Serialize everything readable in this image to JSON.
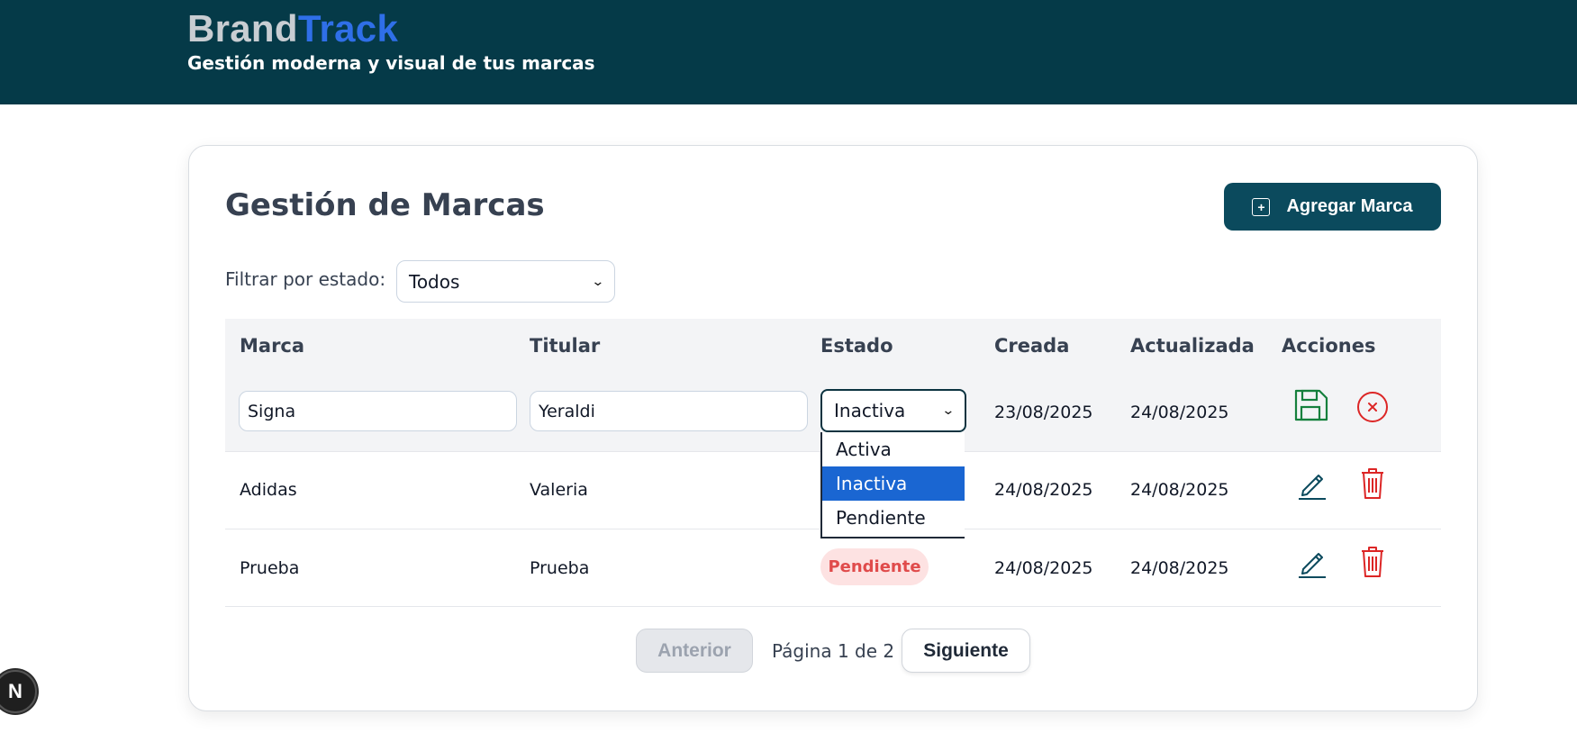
{
  "header": {
    "brand_part1": "Brand",
    "brand_part2": "Track",
    "tagline": "Gestión moderna y visual de tus marcas"
  },
  "main": {
    "title": "Gestión de Marcas",
    "add_button_label": "Agregar Marca",
    "filter_label": "Filtrar por estado:",
    "filter_value": "Todos"
  },
  "table": {
    "columns": [
      "Marca",
      "Titular",
      "Estado",
      "Creada",
      "Actualizada",
      "Acciones"
    ],
    "editing_row": {
      "marca": "Signa",
      "titular": "Yeraldi",
      "estado": "Inactiva",
      "creada": "23/08/2025",
      "actualizada": "24/08/2025"
    },
    "estado_options": [
      "Activa",
      "Inactiva",
      "Pendiente"
    ],
    "rows": [
      {
        "marca": "Adidas",
        "titular": "Valeria",
        "estado": "",
        "creada": "24/08/2025",
        "actualizada": "24/08/2025"
      },
      {
        "marca": "Prueba",
        "titular": "Prueba",
        "estado": "Pendiente",
        "creada": "24/08/2025",
        "actualizada": "24/08/2025"
      }
    ]
  },
  "pagination": {
    "prev_label": "Anterior",
    "page_text": "Página 1 de 2",
    "next_label": "Siguiente"
  },
  "colors": {
    "header_bg": "#053a48",
    "brand_accent": "#2f6fe8",
    "primary_button": "#0b4a5d",
    "save_icon": "#15803d",
    "danger": "#dc2626",
    "selected_option": "#1a66d2"
  },
  "dev_indicator": "N"
}
